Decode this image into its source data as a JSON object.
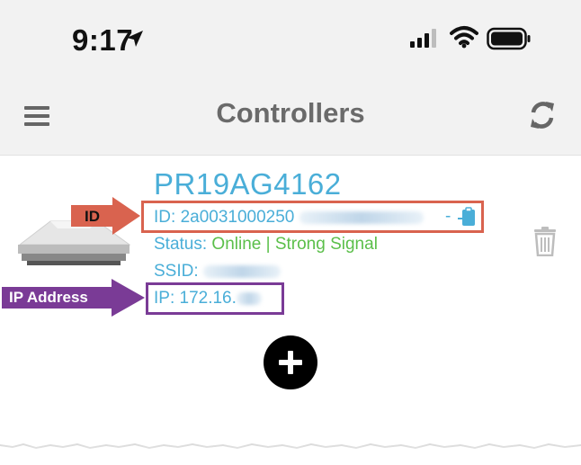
{
  "status_bar": {
    "time": "9:17"
  },
  "nav": {
    "title": "Controllers"
  },
  "controller": {
    "name": "PR19AG4162",
    "id_label": "ID: ",
    "id_value": "2a0031000250",
    "status_label": "Status: ",
    "status_value": "Online | Strong Signal",
    "ssid_label": "SSID:",
    "ip_label": "IP: ",
    "ip_value": "172.16."
  },
  "annotations": {
    "id_callout": "ID",
    "ip_callout": "IP Address",
    "id_color": "#d9634f",
    "ip_color": "#7a3b96"
  },
  "icons": {
    "status_bar": [
      "location-arrow-icon",
      "cellular-signal-icon",
      "wifi-icon",
      "battery-icon"
    ],
    "nav": [
      "hamburger-menu-icon",
      "refresh-icon"
    ],
    "card": [
      "controller-device-image",
      "copy-to-clipboard-icon",
      "trash-icon",
      "plus-icon"
    ]
  },
  "colors": {
    "accent_blue": "#4aaed8",
    "online_green": "#5bbf4a",
    "header_gray": "#6a6a6a",
    "header_background": "#f2f2f2"
  }
}
